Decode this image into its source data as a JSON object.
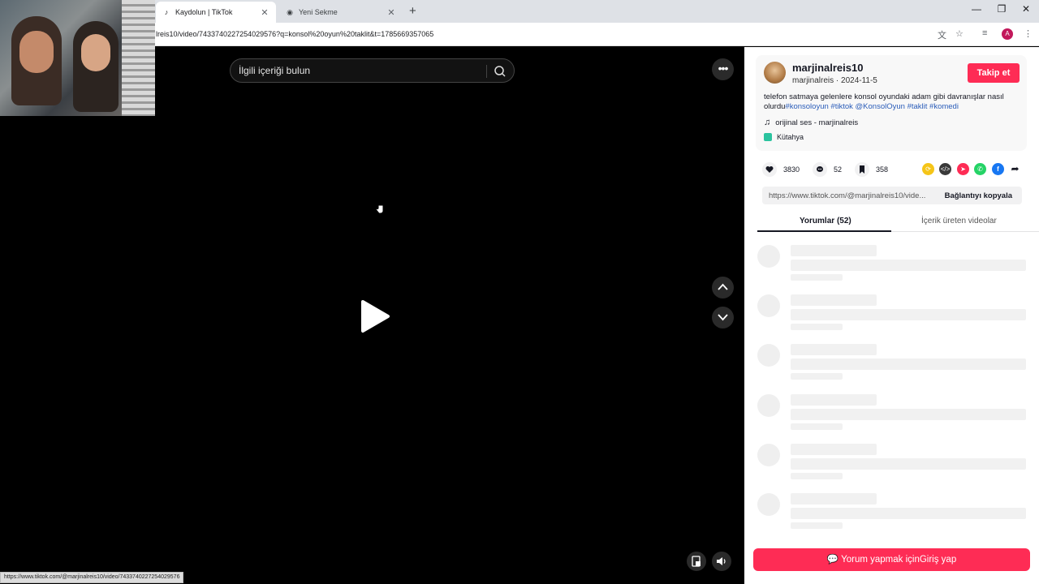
{
  "browser": {
    "tabs": [
      {
        "title": "Kaydolun | TikTok",
        "icon": "tiktok-icon",
        "active": true
      },
      {
        "title": "Yeni Sekme",
        "icon": "chrome-icon",
        "active": false
      }
    ],
    "url": "lreis10/video/7433740227254029576?q=konsol%20oyun%20taklit&t=1785669357065",
    "profile_initial": "A",
    "status_url": "https://www.tiktok.com/@marjinalreis10/video/7433740227254029576"
  },
  "video": {
    "search_placeholder": "İlgili içeriği bulun",
    "icons": [
      "search-icon",
      "more-icon",
      "play-icon",
      "chevron-up-icon",
      "chevron-down-icon",
      "floating-player-icon",
      "volume-icon"
    ]
  },
  "post": {
    "username": "marjinalreis10",
    "meta": "marjinalreis · 2024-11-5",
    "follow_label": "Takip et",
    "description": "telefon satmaya gelenlere konsol oyundaki adam gibi davranışlar nasıl olurdu",
    "hashtags": [
      "#konsoloyun",
      "#tiktok",
      "@KonsolOyun",
      "#taklit",
      "#komedi"
    ],
    "music": "orijinal ses - marjinalreis",
    "location": "Kütahya"
  },
  "stats": {
    "likes": "3830",
    "comments": "52",
    "saves": "358"
  },
  "share": {
    "link": "https://www.tiktok.com/@marjinalreis10/vide...",
    "copy_label": "Bağlantıyı kopyala",
    "colors": {
      "repost": "#f5c518",
      "embed": "#3a3a3a",
      "send": "#fe2c55",
      "whatsapp": "#25d366",
      "facebook": "#1877f2"
    }
  },
  "panel_tabs": {
    "comments": "Yorumlar (52)",
    "creator_videos": "İçerik üreten videolar"
  },
  "comment_login": "Yorum yapmak içinGiriş yap"
}
